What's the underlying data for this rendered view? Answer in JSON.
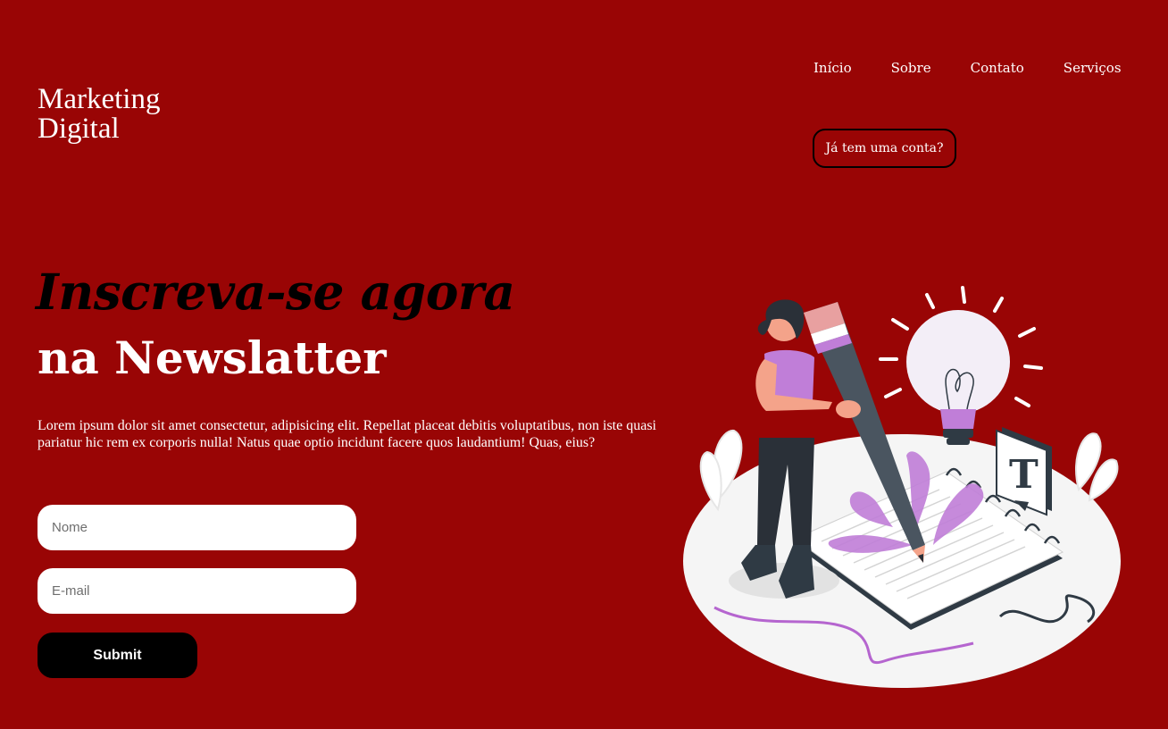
{
  "brand": {
    "line1": "Marketing",
    "line2": "Digital"
  },
  "nav": {
    "items": [
      {
        "label": "Início"
      },
      {
        "label": "Sobre"
      },
      {
        "label": "Contato"
      },
      {
        "label": "Serviços"
      }
    ]
  },
  "account_button": {
    "label": "Já tem uma conta?"
  },
  "hero": {
    "headline_italic": "Inscreva-se agora",
    "headline_bold": "na Newslatter",
    "paragraph": "Lorem ipsum dolor sit amet consectetur, adipisicing elit. Repellat placeat debitis voluptatibus, non iste quasi pariatur hic rem ex corporis nulla! Natus quae optio incidunt facere quos laudantium! Quas, eius?"
  },
  "form": {
    "name_placeholder": "Nome",
    "email_placeholder": "E-mail",
    "submit_label": "Submit"
  },
  "illustration": {
    "icon": "woman-writing-with-giant-pencil-illustration",
    "letter": "T"
  },
  "colors": {
    "background": "#990505",
    "headline_italic": "#000000",
    "button_dark": "#000000",
    "accent_purple": "#c07ed8"
  }
}
